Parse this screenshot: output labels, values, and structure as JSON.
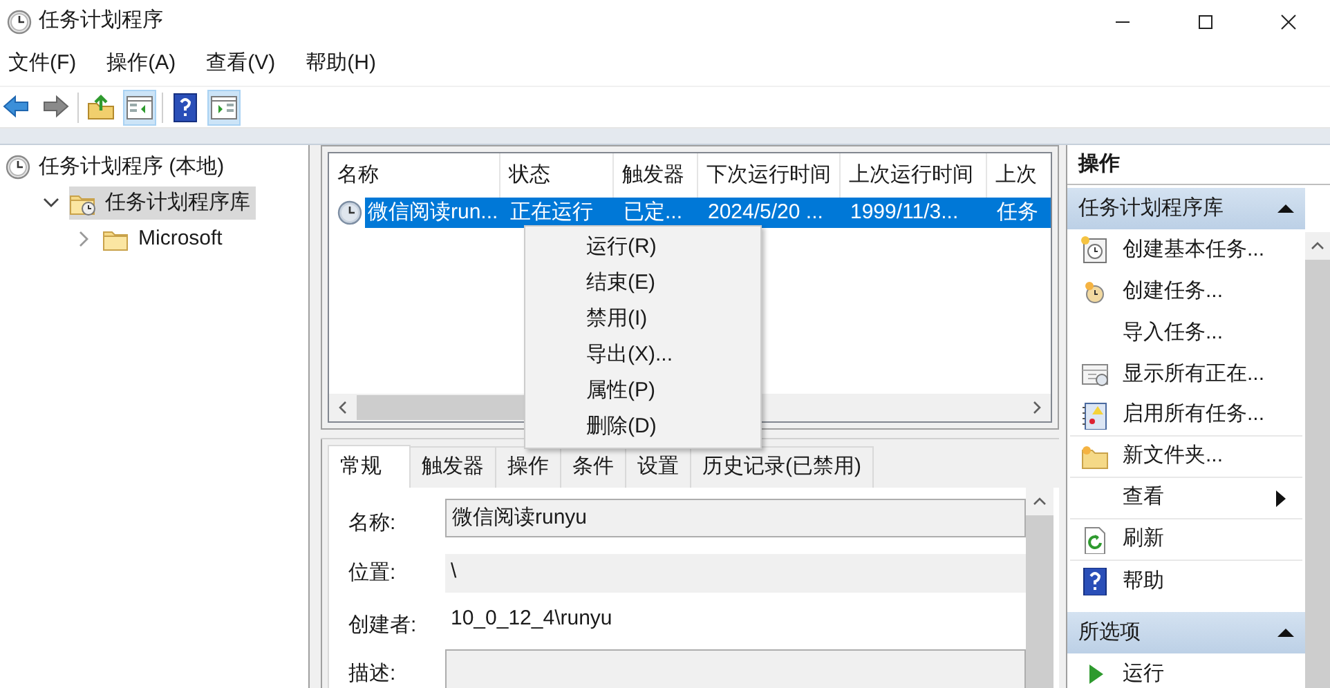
{
  "window": {
    "title": "任务计划程序"
  },
  "menu_bar": [
    "文件(F)",
    "操作(A)",
    "查看(V)",
    "帮助(H)"
  ],
  "toolbar": [
    {
      "kind": "back",
      "on": false
    },
    {
      "kind": "forward",
      "on": false
    },
    {
      "kind": "up",
      "on": false
    },
    {
      "kind": "console_tree",
      "on": true
    },
    {
      "kind": "help",
      "on": false
    },
    {
      "kind": "action_pane",
      "on": true
    }
  ],
  "tree": [
    {
      "label": "任务计划程序 (本地)",
      "selected": false,
      "children": [
        {
          "label": "任务计划程序库",
          "selected": true,
          "expanded": true,
          "children": [
            {
              "label": "Microsoft",
              "selected": false,
              "expanded": false
            }
          ]
        }
      ]
    }
  ],
  "task_list": {
    "columns": [
      "名称",
      "状态",
      "触发器",
      "下次运行时间",
      "上次运行时间",
      "上次"
    ],
    "rows": [
      {
        "selected": true,
        "cells": [
          "微信阅读run...",
          "正在运行",
          "已定...",
          "2024/5/20 ...",
          "1999/11/3...",
          "任务"
        ]
      }
    ]
  },
  "context_menu": [
    "运行(R)",
    "结束(E)",
    "禁用(I)",
    "导出(X)...",
    "属性(P)",
    "删除(D)"
  ],
  "details": {
    "tabs": [
      {
        "label": "常规",
        "selected": true
      },
      {
        "label": "触发器",
        "selected": false
      },
      {
        "label": "操作",
        "selected": false
      },
      {
        "label": "条件",
        "selected": false
      },
      {
        "label": "设置",
        "selected": false
      },
      {
        "label": "历史记录(已禁用)",
        "selected": false
      }
    ],
    "fields": [
      {
        "kind": "input",
        "label": "名称:",
        "value": "微信阅读runyu"
      },
      {
        "kind": "readonly",
        "label": "位置:",
        "value": "\\"
      },
      {
        "kind": "text",
        "label": "创建者:",
        "value": "10_0_12_4\\runyu"
      },
      {
        "kind": "textarea",
        "label": "描述:"
      }
    ]
  },
  "actions": {
    "title": "操作",
    "sections": [
      {
        "title": "任务计划程序库",
        "expanded": true,
        "items": [
          {
            "label": "创建基本任务...",
            "kind": "wizard",
            "separator": false,
            "submenu": false
          },
          {
            "label": "创建任务...",
            "kind": "clock",
            "separator": false,
            "submenu": false
          },
          {
            "label": "导入任务...",
            "kind": "none",
            "separator": false,
            "submenu": false
          },
          {
            "label": "显示所有正在...",
            "kind": "list",
            "separator": false,
            "submenu": false
          },
          {
            "label": "启用所有任务...",
            "kind": "notebook",
            "separator": true,
            "submenu": false
          },
          {
            "label": "新文件夹...",
            "kind": "folder",
            "separator": true,
            "submenu": false
          },
          {
            "label": "查看",
            "kind": "none",
            "separator": true,
            "submenu": true
          },
          {
            "label": "刷新",
            "kind": "refresh",
            "separator": true,
            "submenu": false
          },
          {
            "label": "帮助",
            "kind": "help",
            "separator": false,
            "submenu": false
          }
        ]
      },
      {
        "title": "所选项",
        "expanded": true,
        "items": [
          {
            "label": "运行",
            "kind": "play",
            "separator": false,
            "submenu": false
          }
        ]
      }
    ]
  }
}
